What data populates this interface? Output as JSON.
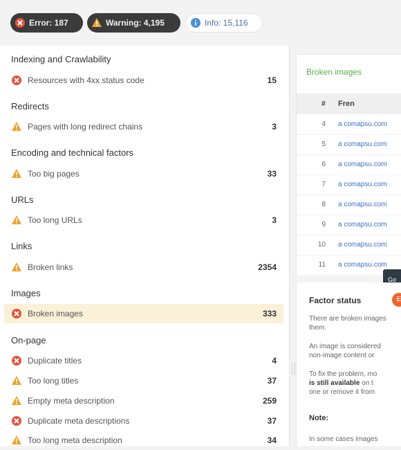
{
  "filters": {
    "error": {
      "label": "Error: 187",
      "icon": "error-icon"
    },
    "warning": {
      "label": "Warning: 4,195",
      "icon": "warning-icon"
    },
    "info": {
      "label": "Info: 15,116",
      "icon": "info-icon"
    }
  },
  "groups": [
    {
      "title": "Indexing and Crawlability",
      "items": [
        {
          "label": "Resources with 4xx status code",
          "count": "15",
          "severity": "error"
        }
      ]
    },
    {
      "title": "Redirects",
      "items": [
        {
          "label": "Pages with long redirect chains",
          "count": "3",
          "severity": "warning"
        }
      ]
    },
    {
      "title": "Encoding and technical factors",
      "items": [
        {
          "label": "Too big pages",
          "count": "33",
          "severity": "warning"
        }
      ]
    },
    {
      "title": "URLs",
      "items": [
        {
          "label": "Too long URLs",
          "count": "3",
          "severity": "warning"
        }
      ]
    },
    {
      "title": "Links",
      "items": [
        {
          "label": "Broken links",
          "count": "2354",
          "severity": "warning"
        }
      ]
    },
    {
      "title": "Images",
      "items": [
        {
          "label": "Broken images",
          "count": "333",
          "severity": "error",
          "selected": true
        }
      ]
    },
    {
      "title": "On-page",
      "items": [
        {
          "label": "Duplicate titles",
          "count": "4",
          "severity": "error"
        },
        {
          "label": "Too long titles",
          "count": "37",
          "severity": "warning"
        },
        {
          "label": "Empty meta description",
          "count": "259",
          "severity": "warning"
        },
        {
          "label": "Duplicate meta descriptions",
          "count": "37",
          "severity": "error"
        },
        {
          "label": "Too long meta description",
          "count": "34",
          "severity": "warning"
        }
      ]
    }
  ],
  "detail": {
    "title": "Broken images",
    "columns": {
      "num": "#",
      "file": "Fren"
    },
    "rows": [
      {
        "num": "4",
        "url": "a comapsu.com"
      },
      {
        "num": "5",
        "url": "a comapsu.com"
      },
      {
        "num": "6",
        "url": "a comapsu.com"
      },
      {
        "num": "7",
        "url": "a comapsu.com"
      },
      {
        "num": "8",
        "url": "a comapsu.com"
      },
      {
        "num": "9",
        "url": "a comapsu.com"
      },
      {
        "num": "10",
        "url": "a comapsu.com"
      },
      {
        "num": "11",
        "url": "a comapsu.com"
      }
    ],
    "tooltip": "Go"
  },
  "factor": {
    "title": "Factor status",
    "badge": "E",
    "p1a": "There are broken images",
    "p1b": "them.",
    "p2a": "An image is considered",
    "p2b": "non-image content or",
    "p3a": "To fix the problem, mo",
    "p3b_bold": "is still available",
    "p3b": " on t",
    "p3c": "one or remove it from",
    "subtitle": "Note:",
    "p4": "In some cases images"
  }
}
